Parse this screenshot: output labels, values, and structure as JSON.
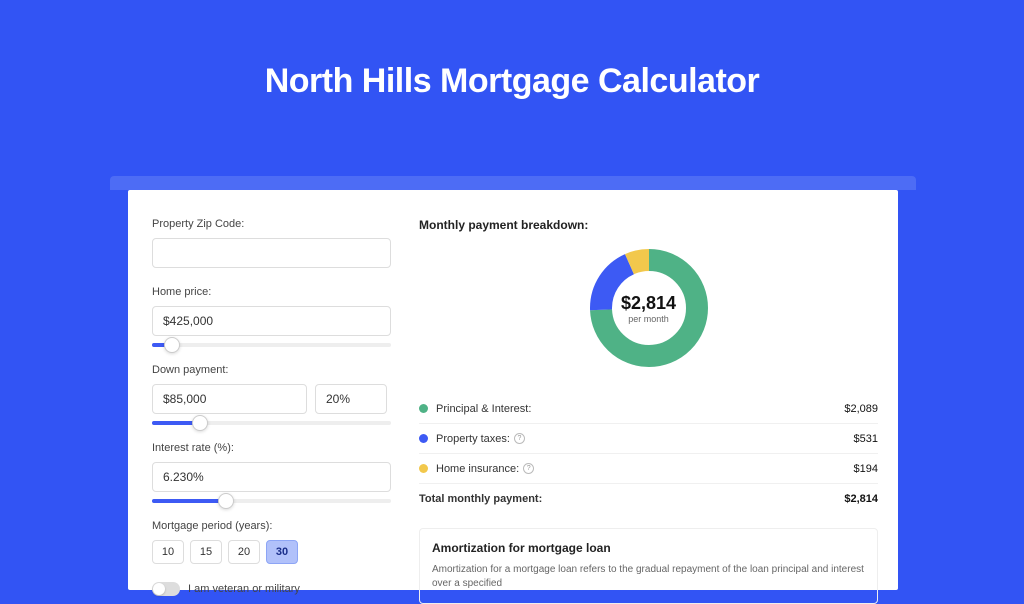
{
  "title": "North Hills Mortgage Calculator",
  "form": {
    "zip_label": "Property Zip Code:",
    "zip_value": "",
    "home_price_label": "Home price:",
    "home_price_value": "$425,000",
    "down_payment_label": "Down payment:",
    "down_payment_value": "$85,000",
    "down_payment_pct": "20%",
    "interest_label": "Interest rate (%):",
    "interest_value": "6.230%",
    "period_label": "Mortgage period (years):",
    "periods": [
      "10",
      "15",
      "20",
      "30"
    ],
    "period_selected": "30",
    "veteran_label": "I am veteran or military"
  },
  "breakdown": {
    "title": "Monthly payment breakdown:",
    "center_value": "$2,814",
    "center_sub": "per month",
    "rows": [
      {
        "label": "Principal & Interest:",
        "value": "$2,089",
        "color": "g"
      },
      {
        "label": "Property taxes:",
        "value": "$531",
        "color": "b",
        "info": true
      },
      {
        "label": "Home insurance:",
        "value": "$194",
        "color": "y",
        "info": true
      }
    ],
    "total_label": "Total monthly payment:",
    "total_value": "$2,814"
  },
  "amort": {
    "title": "Amortization for mortgage loan",
    "text": "Amortization for a mortgage loan refers to the gradual repayment of the loan principal and interest over a specified"
  },
  "chart_data": {
    "type": "pie",
    "title": "Monthly payment breakdown",
    "series": [
      {
        "name": "Principal & Interest",
        "value": 2089,
        "color": "#4fb286"
      },
      {
        "name": "Property taxes",
        "value": 531,
        "color": "#3d5af4"
      },
      {
        "name": "Home insurance",
        "value": 194,
        "color": "#f2c84c"
      }
    ],
    "total": 2814
  }
}
